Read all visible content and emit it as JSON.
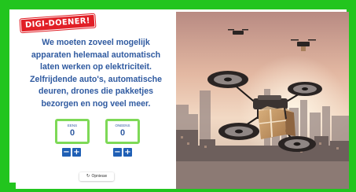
{
  "brand": {
    "logo_text": "DIGI-DOENER!"
  },
  "intro": {
    "text": "We moeten zoveel mogelijk apparaten helemaal automatisch laten werken op elektriciteit. Zelfrijdende auto's, automatische deuren, drones die pakketjes bezorgen en nog veel meer."
  },
  "counters": [
    {
      "label": "EENS",
      "value": "0"
    },
    {
      "label": "ONEENS",
      "value": "0"
    }
  ],
  "controls": {
    "minus": "−",
    "plus": "+"
  },
  "reset": {
    "icon": "↻",
    "label": "Opnieuw"
  },
  "photo": {
    "subject": "drone-carrying-package-over-city"
  },
  "colors": {
    "frame": "#22c51e",
    "text": "#2f5aa0",
    "counter_border": "#7ed957",
    "button": "#1f5fb5",
    "logo": "#e11f26"
  }
}
